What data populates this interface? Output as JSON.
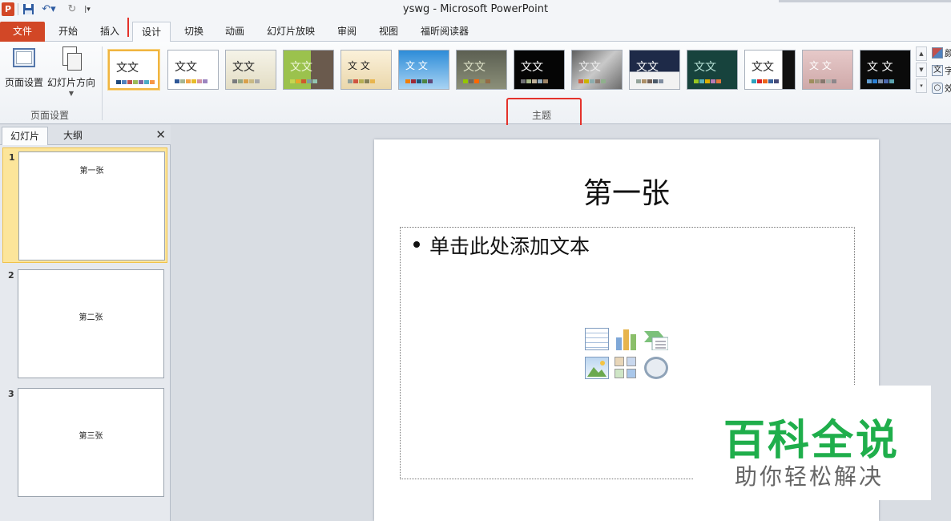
{
  "window": {
    "title": "yswg  -  Microsoft PowerPoint"
  },
  "quick_access": {
    "app_icon": "P",
    "icons": [
      "powerpoint-icon",
      "save-icon",
      "undo-icon",
      "redo-icon",
      "customize-icon"
    ]
  },
  "tabs": [
    "文件",
    "开始",
    "插入",
    "设计",
    "切换",
    "动画",
    "幻灯片放映",
    "审阅",
    "视图",
    "福昕阅读器"
  ],
  "active_tab": "设计",
  "ribbon": {
    "page_setup_group": {
      "page_setup_label": "页面设置",
      "orientation_label": "幻灯片方向",
      "group_label": "页面设置"
    },
    "themes_group": {
      "group_label": "主题",
      "theme_sample_text": "文文",
      "theme_sample_text_alt": "文 文",
      "side_options": [
        {
          "icon": "颜",
          "label": "颜"
        },
        {
          "icon": "文",
          "label": "字"
        },
        {
          "icon": "○",
          "label": "效"
        }
      ]
    }
  },
  "left_panel": {
    "tabs": [
      "幻灯片",
      "大纲"
    ],
    "active_tab": "幻灯片",
    "close": "✕",
    "slides": [
      {
        "number": "1",
        "title": "第一张"
      },
      {
        "number": "2",
        "title": "第二张"
      },
      {
        "number": "3",
        "title": "第三张"
      }
    ]
  },
  "slide": {
    "title": "第一张",
    "placeholder_text": "单击此处添加文本",
    "content_icons": [
      "table-icon",
      "chart-icon",
      "smartart-icon",
      "picture-icon",
      "clipart-icon",
      "media-icon"
    ]
  },
  "watermark": {
    "title": "百科全说",
    "subtitle": "助你轻松解决"
  },
  "colors": {
    "file_tab": "#d24726",
    "selected_theme_border": "#f0b540",
    "annotation": "#e4322b",
    "watermark_green": "#1fae4b"
  }
}
